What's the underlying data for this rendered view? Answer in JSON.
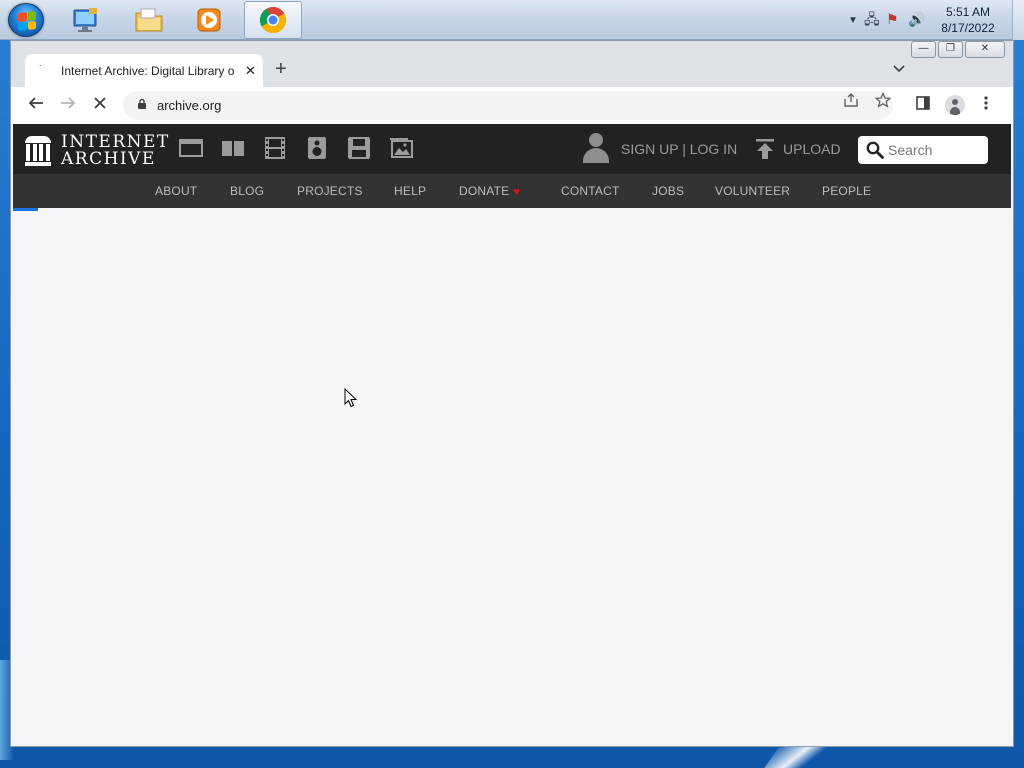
{
  "taskbar": {
    "items": [
      {
        "name": "start-orb"
      },
      {
        "name": "remote-desktop-icon"
      },
      {
        "name": "file-explorer-icon"
      },
      {
        "name": "media-player-icon"
      },
      {
        "name": "chrome-icon"
      }
    ],
    "clock_time": "5:51 AM",
    "clock_date": "8/17/2022"
  },
  "window": {
    "minimize_label": "—",
    "restore_label": "❐",
    "close_label": "✕"
  },
  "browser": {
    "tab_title": "Internet Archive: Digital Library o",
    "new_tab_label": "+",
    "url": "archive.org"
  },
  "page": {
    "logo_line1": "INTERNET",
    "logo_line2": "ARCHIVE",
    "auth_text": "SIGN UP | LOG IN",
    "upload_label": "UPLOAD",
    "search_placeholder": "Search",
    "nav": [
      {
        "label": "ABOUT"
      },
      {
        "label": "BLOG"
      },
      {
        "label": "PROJECTS"
      },
      {
        "label": "HELP"
      },
      {
        "label": "DONATE"
      },
      {
        "label": "CONTACT"
      },
      {
        "label": "JOBS"
      },
      {
        "label": "VOLUNTEER"
      },
      {
        "label": "PEOPLE"
      }
    ]
  },
  "colors": {
    "ia_top_bar": "#222222",
    "ia_nav_bar": "#333333",
    "ia_text_grey": "#9b9b9b",
    "donate_heart": "#e01010",
    "loading_bar": "#1a73e8"
  }
}
